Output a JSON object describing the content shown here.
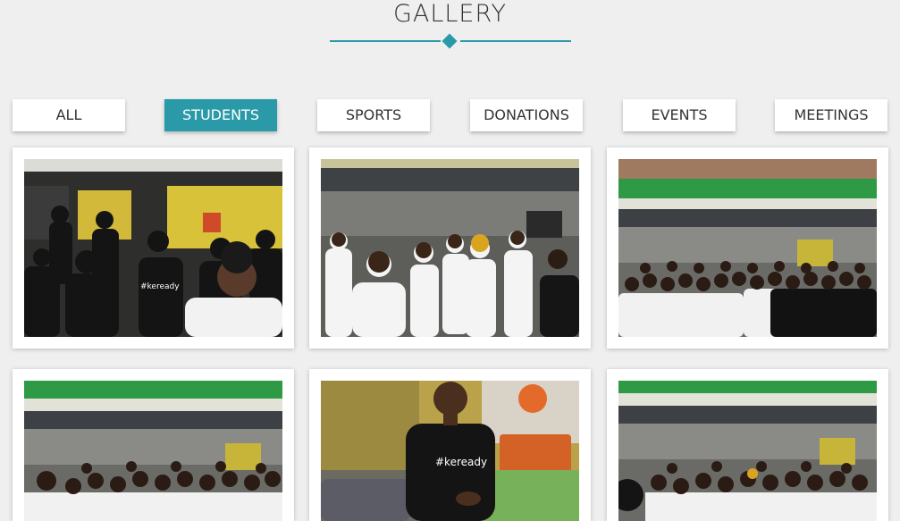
{
  "gallery": {
    "title": "GALLERY"
  },
  "colors": {
    "accent": "#2a9aa8",
    "background": "#efefef"
  },
  "filters": [
    {
      "label": "ALL",
      "active": false
    },
    {
      "label": "STUDENTS",
      "active": true
    },
    {
      "label": "SPORTS",
      "active": false
    },
    {
      "label": "DONATIONS",
      "active": false
    },
    {
      "label": "EVENTS",
      "active": false
    },
    {
      "label": "MEETINGS",
      "active": false
    }
  ],
  "photos": [
    {
      "shirt_text": "#keready",
      "scene": "students in black shirts, woman with glasses in front"
    },
    {
      "shirt_text": "",
      "scene": "students in white shirts in courtyard"
    },
    {
      "shirt_text": "",
      "scene": "large group photo in courtyard with green building"
    },
    {
      "shirt_text": "",
      "scene": "large group photo in courtyard"
    },
    {
      "shirt_text": "#keready",
      "scene": "young man in black #keready shirt indoors"
    },
    {
      "shirt_text": "",
      "scene": "group photo in courtyard"
    }
  ]
}
